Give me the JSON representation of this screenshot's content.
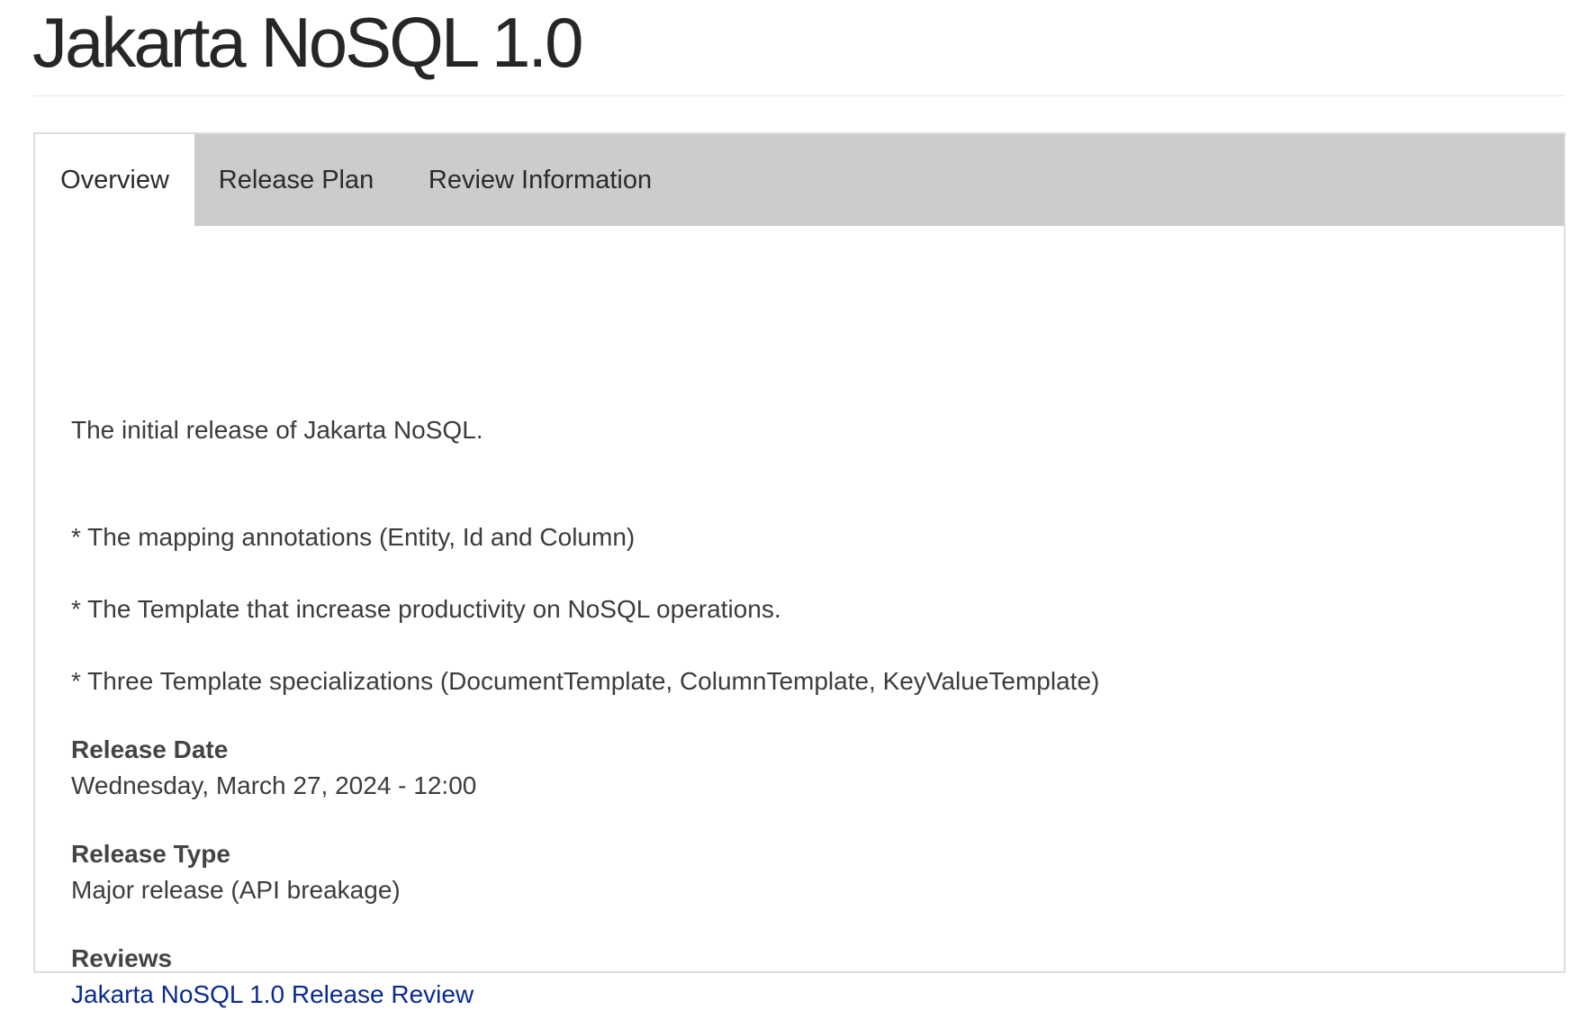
{
  "page": {
    "title": "Jakarta NoSQL 1.0"
  },
  "tabs": [
    {
      "label": "Overview",
      "active": true
    },
    {
      "label": "Release Plan",
      "active": false
    },
    {
      "label": "Review Information",
      "active": false
    }
  ],
  "overview": {
    "intro": "The initial release of Jakarta NoSQL.",
    "bullets": [
      "* The mapping annotations (Entity, Id and Column)",
      "* The Template that increase productivity on NoSQL operations.",
      "* Three Template specializations (DocumentTemplate, ColumnTemplate, KeyValueTemplate)"
    ],
    "release_date_label": "Release Date",
    "release_date_value": "Wednesday, March 27, 2024 - 12:00",
    "release_type_label": "Release Type",
    "release_type_value": "Major release (API breakage)",
    "reviews_label": "Reviews",
    "reviews_link": "Jakarta NoSQL 1.0 Release Review"
  },
  "colors": {
    "tab_bar": "#cccccc",
    "link": "#0b2a8f",
    "border": "#dcdcdc"
  }
}
